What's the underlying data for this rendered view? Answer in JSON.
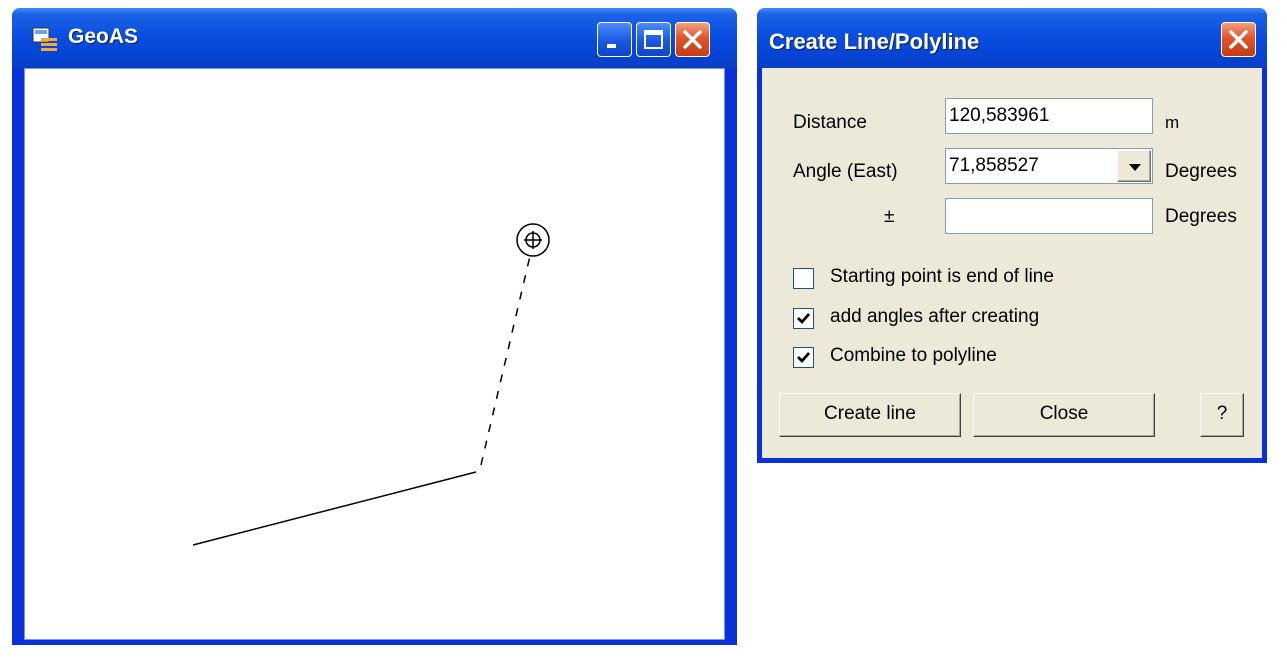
{
  "main_window": {
    "title": "GeoAS",
    "icon": "app-icon",
    "buttons": [
      "minimize-icon",
      "maximize-icon",
      "close-icon"
    ]
  },
  "dialog": {
    "title": "Create Line/Polyline",
    "distance": {
      "label": "Distance",
      "value": "120,583961",
      "unit": "m"
    },
    "angle": {
      "label": "Angle (East)",
      "value": "71,858527",
      "unit": "Degrees"
    },
    "tolerance": {
      "label": "±",
      "value": "",
      "unit": "Degrees"
    },
    "checkboxes": [
      {
        "label": "Starting point is end of line",
        "checked": false
      },
      {
        "label": "add angles after creating",
        "checked": true
      },
      {
        "label": "Combine to polyline",
        "checked": true
      }
    ],
    "buttons": {
      "create": "Create line",
      "close": "Close",
      "help": "?"
    }
  },
  "colors": {
    "titlebar": "#0a4fe0",
    "window_frame": "#0831d9",
    "dialog_face": "#ece9d8",
    "close_button": "#e2552b"
  }
}
